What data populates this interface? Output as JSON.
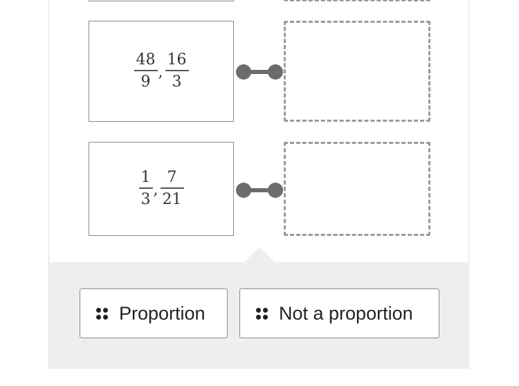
{
  "rows": [
    {
      "fractions": [
        {
          "num": "48",
          "den": "9"
        },
        {
          "num": "16",
          "den": "3"
        }
      ]
    },
    {
      "fractions": [
        {
          "num": "1",
          "den": "3"
        },
        {
          "num": "7",
          "den": "21"
        }
      ]
    }
  ],
  "separator": ",",
  "options": {
    "proportion": "Proportion",
    "not_proportion": "Not a proportion"
  },
  "icons": {
    "drag_handle": "grip-dots-icon",
    "connector": "link-connector-icon"
  },
  "colors": {
    "tray": "#eeeeee",
    "border": "#8a8a8a",
    "dashed": "#9a9a9a",
    "connector": "#6c6c6c"
  }
}
